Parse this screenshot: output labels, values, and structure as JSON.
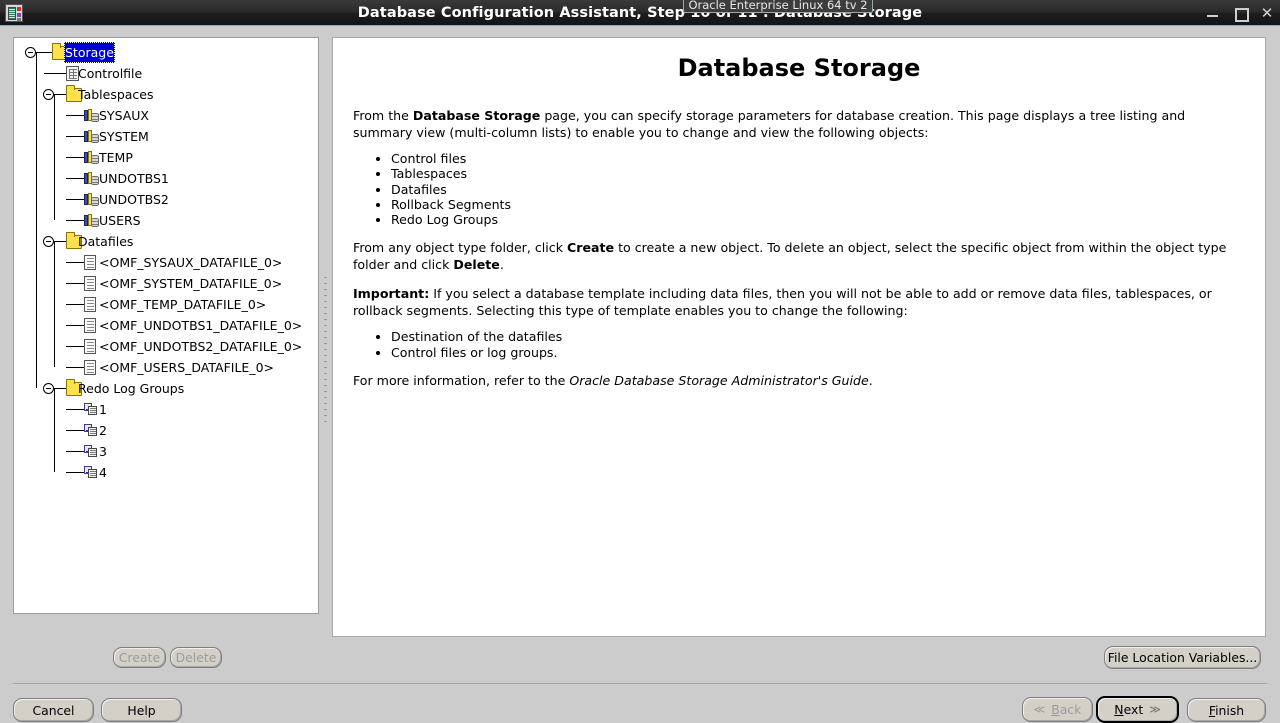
{
  "window": {
    "title": "Database Configuration Assistant, Step 10 of 11 : Database Storage",
    "vm_tooltip": "Oracle Enterprise Linux 64 tv 2",
    "app_icon": "database-app-icon",
    "controls": {
      "minimize": "minimize-icon",
      "maximize": "maximize-icon",
      "close": "close-icon"
    }
  },
  "tree": {
    "nodes": [
      {
        "label": "Storage",
        "icon": "folder-icon",
        "depth": 0,
        "selected": true,
        "expander": "collapse-handle"
      },
      {
        "label": "Controlfile",
        "icon": "controlfile-icon",
        "depth": 1,
        "selected": false,
        "expander": ""
      },
      {
        "label": "Tablespaces",
        "icon": "folder-icon",
        "depth": 1,
        "selected": false,
        "expander": "collapse-handle"
      },
      {
        "label": "SYSAUX",
        "icon": "tablespace-icon",
        "depth": 2,
        "selected": false,
        "expander": ""
      },
      {
        "label": "SYSTEM",
        "icon": "tablespace-icon",
        "depth": 2,
        "selected": false,
        "expander": ""
      },
      {
        "label": "TEMP",
        "icon": "tablespace-icon",
        "depth": 2,
        "selected": false,
        "expander": ""
      },
      {
        "label": "UNDOTBS1",
        "icon": "tablespace-icon",
        "depth": 2,
        "selected": false,
        "expander": ""
      },
      {
        "label": "UNDOTBS2",
        "icon": "tablespace-icon",
        "depth": 2,
        "selected": false,
        "expander": ""
      },
      {
        "label": "USERS",
        "icon": "tablespace-icon",
        "depth": 2,
        "selected": false,
        "expander": ""
      },
      {
        "label": "Datafiles",
        "icon": "folder-icon",
        "depth": 1,
        "selected": false,
        "expander": "collapse-handle"
      },
      {
        "label": "<OMF_SYSAUX_DATAFILE_0>",
        "icon": "datafile-icon",
        "depth": 2,
        "selected": false,
        "expander": ""
      },
      {
        "label": "<OMF_SYSTEM_DATAFILE_0>",
        "icon": "datafile-icon",
        "depth": 2,
        "selected": false,
        "expander": ""
      },
      {
        "label": "<OMF_TEMP_DATAFILE_0>",
        "icon": "datafile-icon",
        "depth": 2,
        "selected": false,
        "expander": ""
      },
      {
        "label": "<OMF_UNDOTBS1_DATAFILE_0>",
        "icon": "datafile-icon",
        "depth": 2,
        "selected": false,
        "expander": ""
      },
      {
        "label": "<OMF_UNDOTBS2_DATAFILE_0>",
        "icon": "datafile-icon",
        "depth": 2,
        "selected": false,
        "expander": ""
      },
      {
        "label": "<OMF_USERS_DATAFILE_0>",
        "icon": "datafile-icon",
        "depth": 2,
        "selected": false,
        "expander": ""
      },
      {
        "label": "Redo Log Groups",
        "icon": "folder-icon",
        "depth": 1,
        "selected": false,
        "expander": "collapse-handle"
      },
      {
        "label": "1",
        "icon": "redolog-icon",
        "depth": 2,
        "selected": false,
        "expander": ""
      },
      {
        "label": "2",
        "icon": "redolog-icon",
        "depth": 2,
        "selected": false,
        "expander": ""
      },
      {
        "label": "3",
        "icon": "redolog-icon",
        "depth": 2,
        "selected": false,
        "expander": ""
      },
      {
        "label": "4",
        "icon": "redolog-icon",
        "depth": 2,
        "selected": false,
        "expander": ""
      }
    ]
  },
  "panel": {
    "heading": "Database Storage",
    "para1_a": "From the ",
    "para1_b": "Database Storage",
    "para1_c": " page, you can specify storage parameters for database creation. This page displays a tree listing and summary view (multi-column lists) to enable you to change and view the following objects:",
    "bullets1": [
      "Control files",
      "Tablespaces",
      "Datafiles",
      "Rollback Segments",
      "Redo Log Groups"
    ],
    "para2_a": "From any object type folder, click ",
    "para2_b": "Create",
    "para2_c": " to create a new object. To delete an object, select the specific object from within the object type folder and click ",
    "para2_d": "Delete",
    "para2_e": ".",
    "para3_a": "Important:",
    "para3_b": " If you select a database template including data files, then you will not be able to add or remove data files, tablespaces, or rollback segments. Selecting this type of template enables you to change the following:",
    "bullets2": [
      "Destination of the datafiles",
      "Control files or log groups."
    ],
    "para4_a": "For more information, refer to the ",
    "para4_b": "Oracle Database Storage Administrator's Guide",
    "para4_c": "."
  },
  "buttons": {
    "create": "Create",
    "delete": "Delete",
    "file_location_variables": "File Location Variables...",
    "cancel": "Cancel",
    "help": "Help",
    "back": "Back",
    "next": "Next",
    "finish": "Finish",
    "back_arrow": "≪",
    "next_arrow": "≫"
  },
  "colors": {
    "selection_blue": "#0000cc",
    "window_bg": "#cccccc",
    "panel_white": "#ffffff",
    "folder_yellow": "#ffe14d",
    "titlebar_dark": "#1d1d1d"
  }
}
